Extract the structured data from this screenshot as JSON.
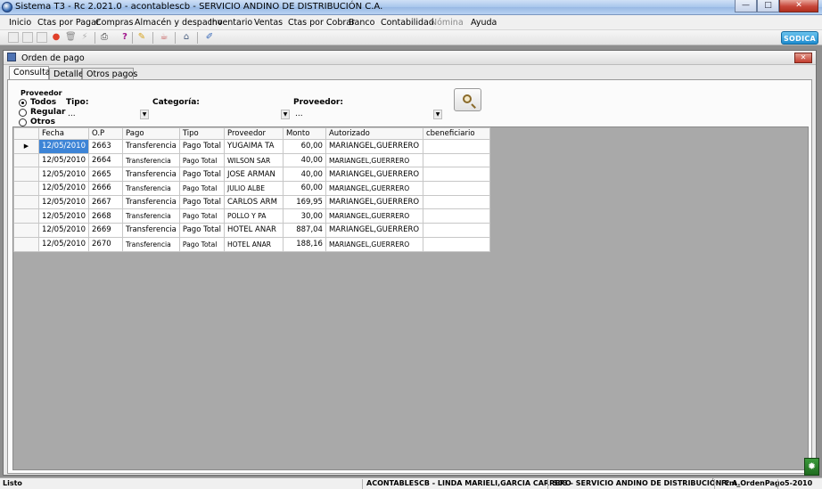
{
  "window": {
    "title": "Sistema T3 - Rc 2.021.0 - acontablescb - SERVICIO ANDINO DE DISTRIBUCIÓN C.A.",
    "buttons": {
      "minimize": "—",
      "maximize": "□",
      "close": "✕"
    }
  },
  "menu": [
    {
      "label": "Inicio",
      "enabled": true
    },
    {
      "label": "Ctas por Pagar",
      "enabled": true
    },
    {
      "label": "Compras",
      "enabled": true
    },
    {
      "label": "Almacén y despacho",
      "enabled": true
    },
    {
      "label": "Inventario",
      "enabled": true
    },
    {
      "label": "Ventas",
      "enabled": true
    },
    {
      "label": "Ctas por Cobrar",
      "enabled": true
    },
    {
      "label": "Banco",
      "enabled": true
    },
    {
      "label": "Contabilidad",
      "enabled": true
    },
    {
      "label": "Nómina",
      "enabled": false
    },
    {
      "label": "Ayuda",
      "enabled": true
    }
  ],
  "toolbar": {
    "logo": "SODICA"
  },
  "form": {
    "title": "Orden de pago",
    "tabs": [
      "Consulta",
      "Detalle",
      "Otros pagos"
    ],
    "active_tab": "Consulta",
    "filters": {
      "proveedor_group_label": "Proveedor",
      "radios": [
        {
          "label": "Todos",
          "checked": true
        },
        {
          "label": "Regular",
          "checked": false
        },
        {
          "label": "Otros",
          "checked": false
        }
      ],
      "tipo_label": "Tipo:",
      "tipo_value": "...",
      "categoria_label": "Categoría:",
      "categoria_value": "",
      "proveedor_label": "Proveedor:",
      "proveedor_value": "..."
    },
    "grid": {
      "columns": [
        "Fecha",
        "O.P",
        "Pago",
        "Tipo",
        "Proveedor",
        "Monto",
        "Autorizado",
        "cbeneficiario"
      ],
      "rows": [
        [
          "12/05/2010",
          "2663",
          "Transferencia",
          "Pago Total",
          "YUGAIMA TA",
          "60,00",
          "MARIANGEL,GUERRERO",
          ""
        ],
        [
          "12/05/2010",
          "2664",
          "Transferencia",
          "Pago Total",
          "WILSON SAR",
          "40,00",
          "MARIANGEL,GUERRERO",
          ""
        ],
        [
          "12/05/2010",
          "2665",
          "Transferencia",
          "Pago Total",
          "JOSE ARMAN",
          "40,00",
          "MARIANGEL,GUERRERO",
          ""
        ],
        [
          "12/05/2010",
          "2666",
          "Transferencia",
          "Pago Total",
          "JULIO ALBE",
          "60,00",
          "MARIANGEL,GUERRERO",
          ""
        ],
        [
          "12/05/2010",
          "2667",
          "Transferencia",
          "Pago Total",
          "CARLOS ARM",
          "169,95",
          "MARIANGEL,GUERRERO",
          ""
        ],
        [
          "12/05/2010",
          "2668",
          "Transferencia",
          "Pago Total",
          "POLLO Y PA",
          "30,00",
          "MARIANGEL,GUERRERO",
          ""
        ],
        [
          "12/05/2010",
          "2669",
          "Transferencia",
          "Pago Total",
          "HOTEL ANAR",
          "887,04",
          "MARIANGEL,GUERRERO",
          ""
        ],
        [
          "12/05/2010",
          "2670",
          "Transferencia",
          "Pago Total",
          "HOTEL ANAR",
          "188,16",
          "MARIANGEL,GUERRERO",
          ""
        ]
      ],
      "current_row_marker": "▶"
    }
  },
  "status": {
    "state": "Listo",
    "user": "ACONTABLESCB - LINDA MARIELI,GARCIA CARRERO",
    "company": "S03 - SERVICIO ANDINO DE DISTRIBUCIÓN C.A.",
    "form_name": "Frm_OrdenPago",
    "period": "5-2010"
  },
  "colors": {
    "selection": "#3d84d6",
    "workspace": "#8e8e8e",
    "grid_empty": "#a9a9a9"
  }
}
